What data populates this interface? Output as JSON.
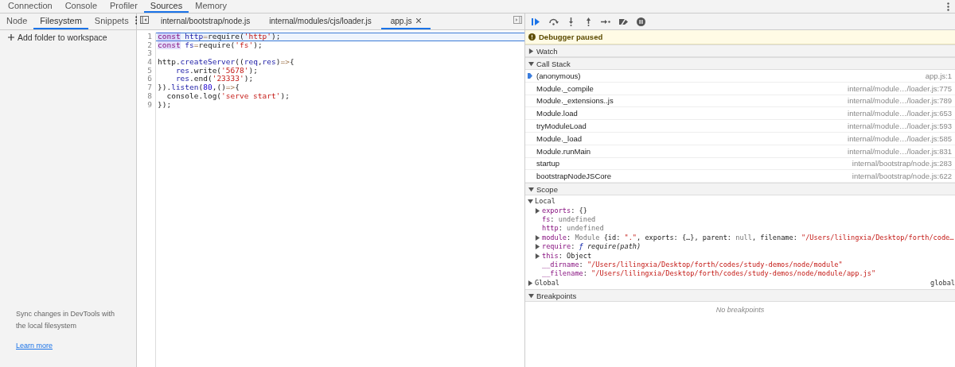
{
  "main_tabs": [
    {
      "label": "Connection",
      "selected": false
    },
    {
      "label": "Console",
      "selected": false
    },
    {
      "label": "Profiler",
      "selected": false
    },
    {
      "label": "Sources",
      "selected": true
    },
    {
      "label": "Memory",
      "selected": false
    }
  ],
  "navigator": {
    "tabs": [
      {
        "label": "Node",
        "selected": false
      },
      {
        "label": "Filesystem",
        "selected": true
      },
      {
        "label": "Snippets",
        "selected": false
      }
    ],
    "add_folder": "Add folder to workspace",
    "sync_text": "Sync changes in DevTools with the local filesystem",
    "learn_more": "Learn more"
  },
  "editor": {
    "tabs": [
      {
        "label": "internal/bootstrap/node.js",
        "selected": false
      },
      {
        "label": "internal/modules/cjs/loader.js",
        "selected": false
      },
      {
        "label": "app.js",
        "selected": true
      }
    ],
    "lines": [
      {
        "number": "1",
        "current": true,
        "tokens": [
          {
            "t": "const",
            "kind": "kw"
          },
          {
            "t": " http",
            "kind": "var"
          },
          {
            "t": "=",
            "kind": "op"
          },
          {
            "t": "require(",
            "kind": "plain"
          },
          {
            "t": "'http'",
            "kind": "str"
          },
          {
            "t": ");",
            "kind": "plain"
          }
        ]
      },
      {
        "number": "2",
        "current": false,
        "tokens": [
          {
            "t": "const",
            "kind": "kw"
          },
          {
            "t": " fs",
            "kind": "var"
          },
          {
            "t": "=",
            "kind": "op"
          },
          {
            "t": "require(",
            "kind": "plain"
          },
          {
            "t": "'fs'",
            "kind": "str"
          },
          {
            "t": ");",
            "kind": "plain"
          }
        ]
      },
      {
        "number": "3",
        "current": false
      },
      {
        "number": "4",
        "current": false,
        "tokens": [
          {
            "t": "http.",
            "kind": "plain"
          },
          {
            "t": "createServer",
            "kind": "var"
          },
          {
            "t": "((",
            "kind": "plain"
          },
          {
            "t": "req",
            "kind": "var"
          },
          {
            "t": ",",
            "kind": "plain"
          },
          {
            "t": "res",
            "kind": "var"
          },
          {
            "t": ")",
            "kind": "plain"
          },
          {
            "t": "=>",
            "kind": "op"
          },
          {
            "t": "{",
            "kind": "plain"
          }
        ]
      },
      {
        "number": "5",
        "current": false,
        "tokens": [
          {
            "t": "    res",
            "kind": "var"
          },
          {
            "t": ".write(",
            "kind": "plain"
          },
          {
            "t": "'5678'",
            "kind": "str"
          },
          {
            "t": ");",
            "kind": "plain"
          }
        ]
      },
      {
        "number": "6",
        "current": false,
        "tokens": [
          {
            "t": "    res",
            "kind": "var"
          },
          {
            "t": ".end(",
            "kind": "plain"
          },
          {
            "t": "'23333'",
            "kind": "str"
          },
          {
            "t": ");",
            "kind": "plain"
          }
        ]
      },
      {
        "number": "7",
        "current": false,
        "tokens": [
          {
            "t": "}).",
            "kind": "plain"
          },
          {
            "t": "listen",
            "kind": "var"
          },
          {
            "t": "(",
            "kind": "plain"
          },
          {
            "t": "80",
            "kind": "num"
          },
          {
            "t": ",()",
            "kind": "plain"
          },
          {
            "t": "=>",
            "kind": "op"
          },
          {
            "t": "{",
            "kind": "plain"
          }
        ]
      },
      {
        "number": "8",
        "current": false,
        "tokens": [
          {
            "t": "  console.log(",
            "kind": "plain"
          },
          {
            "t": "'serve start'",
            "kind": "str"
          },
          {
            "t": ");",
            "kind": "plain"
          }
        ]
      },
      {
        "number": "9",
        "current": false,
        "tokens": [
          {
            "t": "});",
            "kind": "plain"
          }
        ]
      }
    ]
  },
  "debugger": {
    "paused_message": "Debugger paused",
    "watch": {
      "title": "Watch",
      "expanded": false
    },
    "call_stack": {
      "title": "Call Stack",
      "expanded": true,
      "frames": [
        {
          "name": "(anonymous)",
          "location": "app.js:1",
          "selected": true
        },
        {
          "name": "Module._compile",
          "location": "internal/module…/loader.js:775",
          "selected": false
        },
        {
          "name": "Module._extensions..js",
          "location": "internal/module…/loader.js:789",
          "selected": false
        },
        {
          "name": "Module.load",
          "location": "internal/module…/loader.js:653",
          "selected": false
        },
        {
          "name": "tryModuleLoad",
          "location": "internal/module…/loader.js:593",
          "selected": false
        },
        {
          "name": "Module._load",
          "location": "internal/module…/loader.js:585",
          "selected": false
        },
        {
          "name": "Module.runMain",
          "location": "internal/module…/loader.js:831",
          "selected": false
        },
        {
          "name": "startup",
          "location": "internal/bootstrap/node.js:283",
          "selected": false
        },
        {
          "name": "bootstrapNodeJSCore",
          "location": "internal/bootstrap/node.js:622",
          "selected": false
        }
      ]
    },
    "scope": {
      "title": "Scope",
      "expanded": true,
      "local": {
        "label": "Local",
        "expanded": true,
        "entries": [
          {
            "name": "exports",
            "expandable": true,
            "tokens": [
              {
                "t": ": ",
                "kind": "plain"
              },
              {
                "t": "{}",
                "kind": "plain"
              }
            ]
          },
          {
            "name": "fs",
            "expandable": false,
            "tokens": [
              {
                "t": ": ",
                "kind": "plain"
              },
              {
                "t": "undefined",
                "kind": "dim"
              }
            ]
          },
          {
            "name": "http",
            "expandable": false,
            "tokens": [
              {
                "t": ": ",
                "kind": "plain"
              },
              {
                "t": "undefined",
                "kind": "dim"
              }
            ]
          },
          {
            "name": "module",
            "expandable": true,
            "tokens": [
              {
                "t": ": ",
                "kind": "plain"
              },
              {
                "t": "Module ",
                "kind": "dim"
              },
              {
                "t": "{id: ",
                "kind": "plain"
              },
              {
                "t": "\".\"",
                "kind": "str"
              },
              {
                "t": ", exports: {…}, parent: ",
                "kind": "plain"
              },
              {
                "t": "null",
                "kind": "dim"
              },
              {
                "t": ", filename: ",
                "kind": "plain"
              },
              {
                "t": "\"/Users/lilingxia/Desktop/forth/code…",
                "kind": "str"
              }
            ]
          },
          {
            "name": "require",
            "expandable": true,
            "tokens": [
              {
                "t": ": ",
                "kind": "plain"
              },
              {
                "t": "ƒ ",
                "kind": "fn"
              },
              {
                "t": "require(path)",
                "kind": "italic"
              }
            ]
          },
          {
            "name": "this",
            "expandable": true,
            "tokens": [
              {
                "t": ": ",
                "kind": "plain"
              },
              {
                "t": "Object",
                "kind": "plain"
              }
            ]
          },
          {
            "name": "__dirname",
            "expandable": false,
            "tokens": [
              {
                "t": ": ",
                "kind": "plain"
              },
              {
                "t": "\"/Users/lilingxia/Desktop/forth/codes/study-demos/node/module\"",
                "kind": "str"
              }
            ]
          },
          {
            "name": "__filename",
            "expandable": false,
            "tokens": [
              {
                "t": ": ",
                "kind": "plain"
              },
              {
                "t": "\"/Users/lilingxia/Desktop/forth/codes/study-demos/node/module/app.js\"",
                "kind": "str"
              }
            ]
          }
        ]
      },
      "global": {
        "label": "Global",
        "expanded": false,
        "value": "global"
      }
    },
    "breakpoints": {
      "title": "Breakpoints",
      "expanded": true,
      "empty_text": "No breakpoints"
    }
  }
}
